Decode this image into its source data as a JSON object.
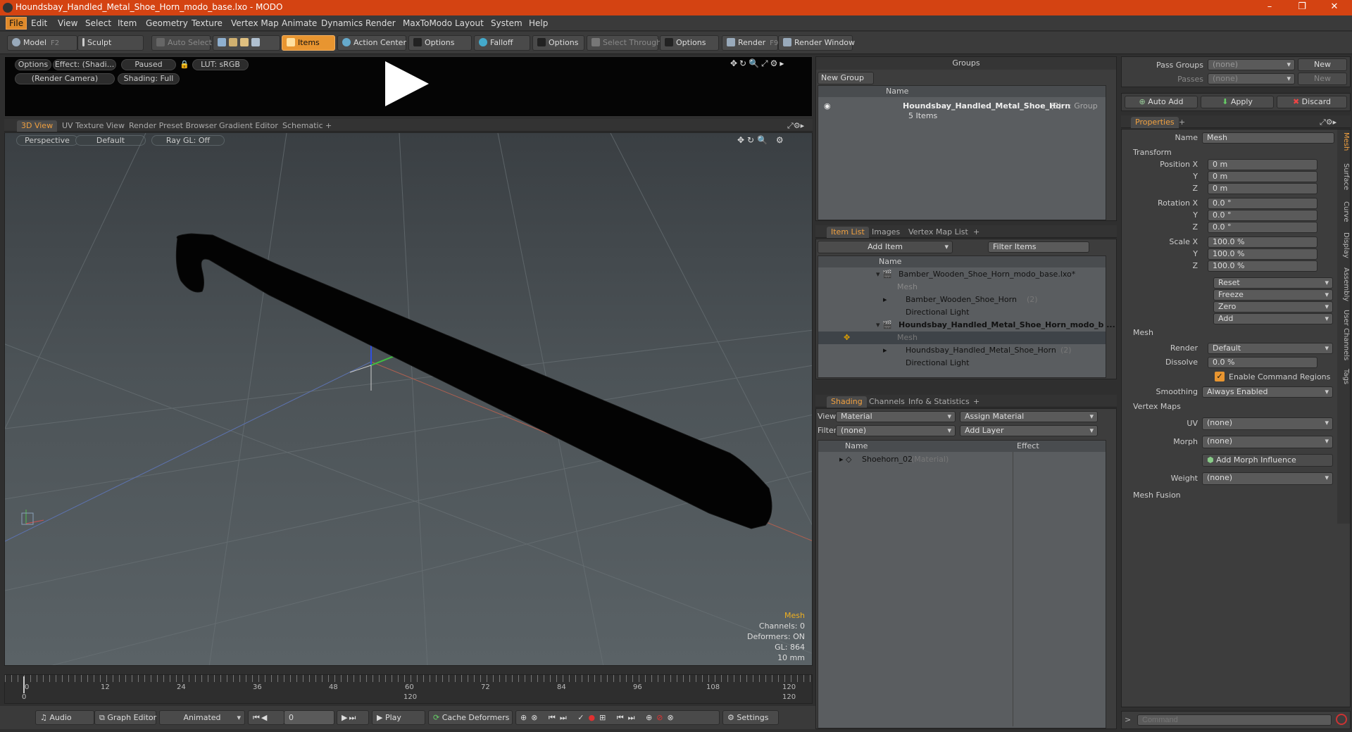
{
  "window": {
    "title": "Houndsbay_Handled_Metal_Shoe_Horn_modo_base.lxo - MODO"
  },
  "menu": [
    "File",
    "Edit",
    "View",
    "Select",
    "Item",
    "Geometry",
    "Texture",
    "Vertex Map",
    "Animate",
    "Dynamics",
    "Render",
    "MaxToModo",
    "Layout",
    "System",
    "Help"
  ],
  "toolbar": {
    "model": "Model",
    "model_key": "F2",
    "sculpt": "Sculpt",
    "auto_select": "Auto Select",
    "items": "Items",
    "action_center": "Action Center",
    "options1": "Options",
    "falloff": "Falloff",
    "options2": "Options",
    "select_through": "Select Through",
    "options3": "Options",
    "render": "Render",
    "render_key": "F9",
    "render_window": "Render Window"
  },
  "preview": {
    "options": "Options",
    "effect": "Effect: (Shadi...",
    "paused": "Paused",
    "lut": "LUT: sRGB",
    "camera": "(Render Camera)",
    "shading": "Shading: Full"
  },
  "view_tabs": [
    "3D View",
    "UV Texture View",
    "Render Preset Browser",
    "Gradient Editor",
    "Schematic"
  ],
  "viewport": {
    "perspective": "Perspective",
    "default": "Default",
    "raygl": "Ray GL: Off",
    "stats": {
      "mesh": "Mesh",
      "channels": "Channels: 0",
      "deformers": "Deformers: ON",
      "gl": "GL: 864",
      "size": "10 mm"
    }
  },
  "timeline": {
    "ticks": [
      "0",
      "12",
      "24",
      "36",
      "48",
      "60",
      "72",
      "84",
      "96",
      "108",
      "120"
    ],
    "sub": [
      "0",
      "120",
      "120"
    ]
  },
  "bottom": {
    "audio": "Audio",
    "graph_editor": "Graph Editor",
    "animated": "Animated",
    "frame": "0",
    "play": "Play",
    "cache_deformers": "Cache Deformers",
    "settings": "Settings"
  },
  "groups": {
    "title": "Groups",
    "new_group": "New Group",
    "col_name": "Name",
    "item_name": "Houndsbay_Handled_Metal_Shoe_Horn",
    "item_count": "(3)",
    "item_type": ": Group",
    "item_sub": "5 Items"
  },
  "itemlist": {
    "tabs": [
      "Item List",
      "Images",
      "Vertex Map List"
    ],
    "add_item": "Add Item",
    "filter": "Filter Items",
    "col_name": "Name",
    "rows": [
      {
        "text": "Bamber_Wooden_Shoe_Horn_modo_base.lxo*"
      },
      {
        "text": "Mesh"
      },
      {
        "text": "Bamber_Wooden_Shoe_Horn",
        "count": "(2)"
      },
      {
        "text": "Directional Light"
      },
      {
        "text": "Houndsbay_Handled_Metal_Shoe_Horn_modo_b ..."
      },
      {
        "text": "Mesh"
      },
      {
        "text": "Houndsbay_Handled_Metal_Shoe_Horn",
        "count": "(2)"
      },
      {
        "text": "Directional Light"
      }
    ]
  },
  "shading": {
    "tabs": [
      "Shading",
      "Channels",
      "Info & Statistics"
    ],
    "view_label": "View",
    "view_value": "Material",
    "assign_material": "Assign Material",
    "filter_label": "Filter",
    "filter_value": "(none)",
    "add_layer": "Add Layer",
    "col_name": "Name",
    "col_effect": "Effect",
    "row_name": "Shoehorn_02",
    "row_type": "(Material)"
  },
  "passes": {
    "pass_groups": "Pass Groups",
    "passes": "Passes",
    "none": "(none)",
    "new": "New"
  },
  "actions": {
    "auto_add": "Auto Add",
    "apply": "Apply",
    "discard": "Discard"
  },
  "properties": {
    "tab": "Properties",
    "name_label": "Name",
    "name_value": "Mesh",
    "transform": "Transform",
    "position_label": "Position X",
    "pos": [
      "0 m",
      "0 m",
      "0 m"
    ],
    "rotation_label": "Rotation X",
    "rot": [
      "0.0 °",
      "0.0 °",
      "0.0 °"
    ],
    "scale_label": "Scale X",
    "scale": [
      "100.0 %",
      "100.0 %",
      "100.0 %"
    ],
    "y": "Y",
    "z": "Z",
    "reset": "Reset",
    "freeze": "Freeze",
    "zero": "Zero",
    "add": "Add",
    "mesh": "Mesh",
    "render_label": "Render",
    "render_value": "Default",
    "dissolve_label": "Dissolve",
    "dissolve_value": "0.0 %",
    "enable_cmd": "Enable Command Regions",
    "smoothing_label": "Smoothing",
    "smoothing_value": "Always Enabled",
    "vertex_maps": "Vertex Maps",
    "uv_label": "UV",
    "uv_value": "(none)",
    "morph_label": "Morph",
    "morph_value": "(none)",
    "add_morph": "Add Morph Influence",
    "weight_label": "Weight",
    "weight_value": "(none)",
    "mesh_fusion": "Mesh Fusion",
    "side_tabs": [
      "Mesh",
      "Surface",
      "Curve",
      "Display",
      "Assembly",
      "User Channels",
      "Tags"
    ]
  },
  "command": {
    "placeholder": "Command"
  }
}
